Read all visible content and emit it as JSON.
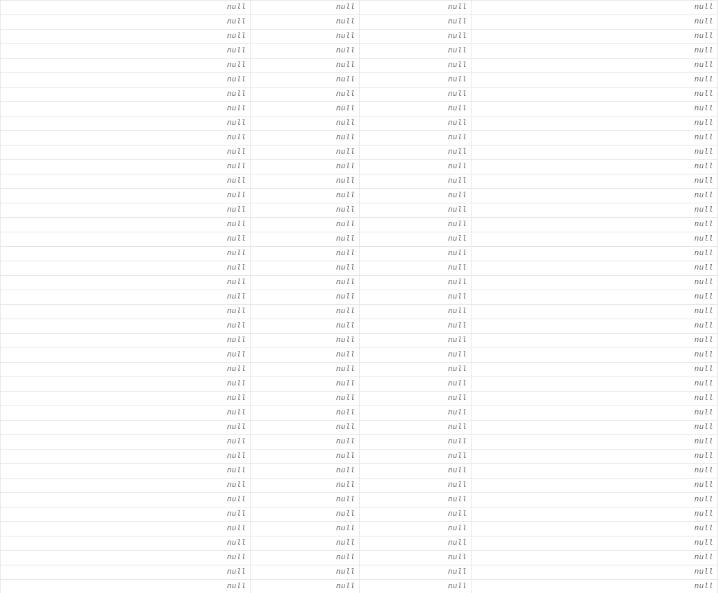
{
  "table": {
    "null_label": "null",
    "column_count": 4,
    "row_count": 41
  }
}
